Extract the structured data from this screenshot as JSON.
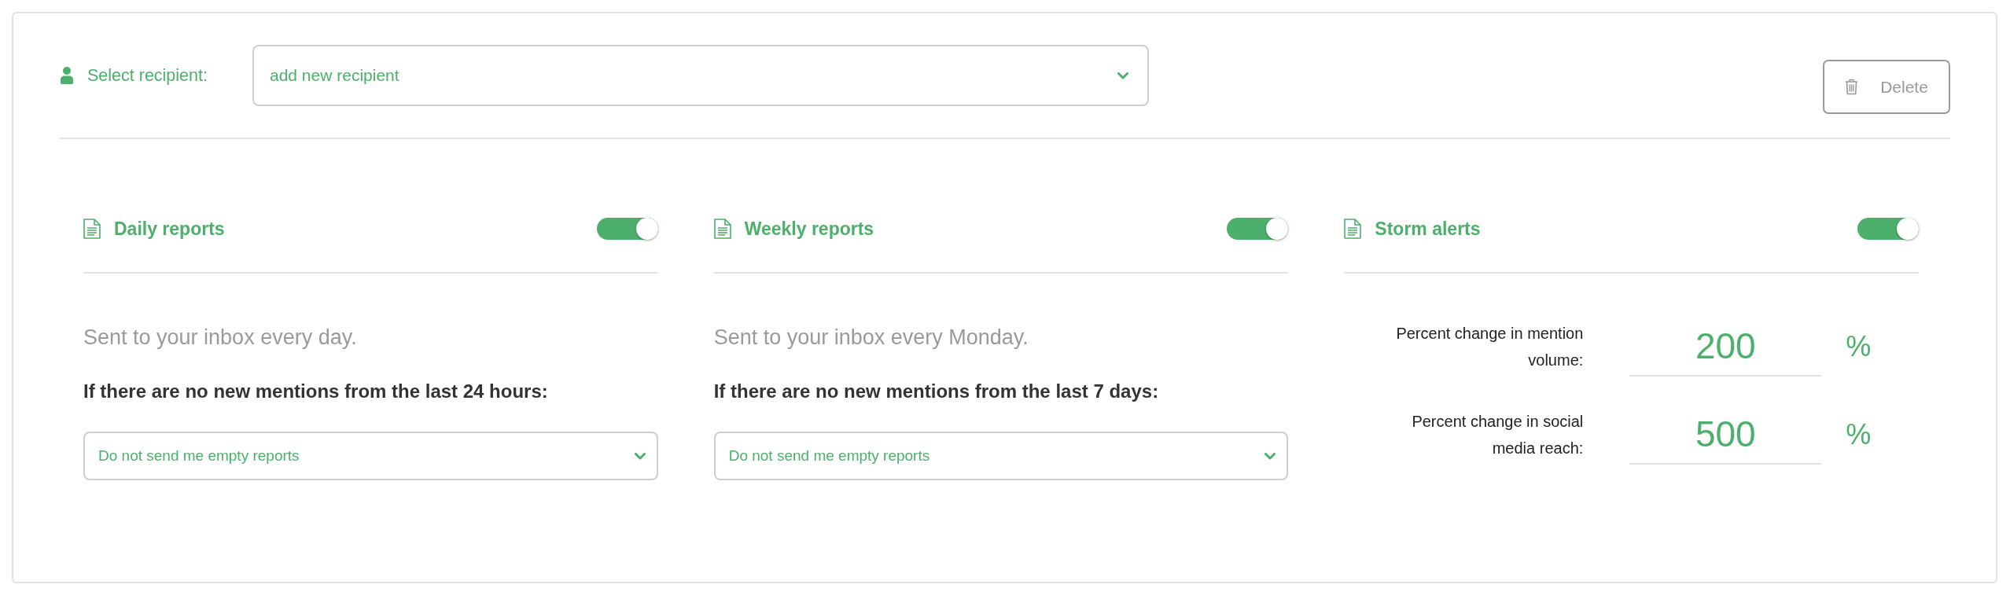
{
  "recipient": {
    "label": "Select recipient:",
    "value": "add new recipient"
  },
  "delete_button": {
    "label": "Delete"
  },
  "sections": [
    {
      "kind": "report",
      "title": "Daily reports",
      "on": true,
      "description": "Sent to your inbox every day.",
      "question": "If there are no new mentions from the last 24 hours:",
      "option": "Do not send me empty reports"
    },
    {
      "kind": "report",
      "title": "Weekly reports",
      "on": true,
      "description": "Sent to your inbox every Monday.",
      "question": "If there are no new mentions from the last 7 days:",
      "option": "Do not send me empty reports"
    },
    {
      "kind": "alerts",
      "title": "Storm alerts",
      "on": true,
      "thresholds": [
        {
          "label": "Percent change in mention volume:",
          "value": "200",
          "unit": "%"
        },
        {
          "label": "Percent change in social media reach:",
          "value": "500",
          "unit": "%"
        }
      ]
    }
  ]
}
